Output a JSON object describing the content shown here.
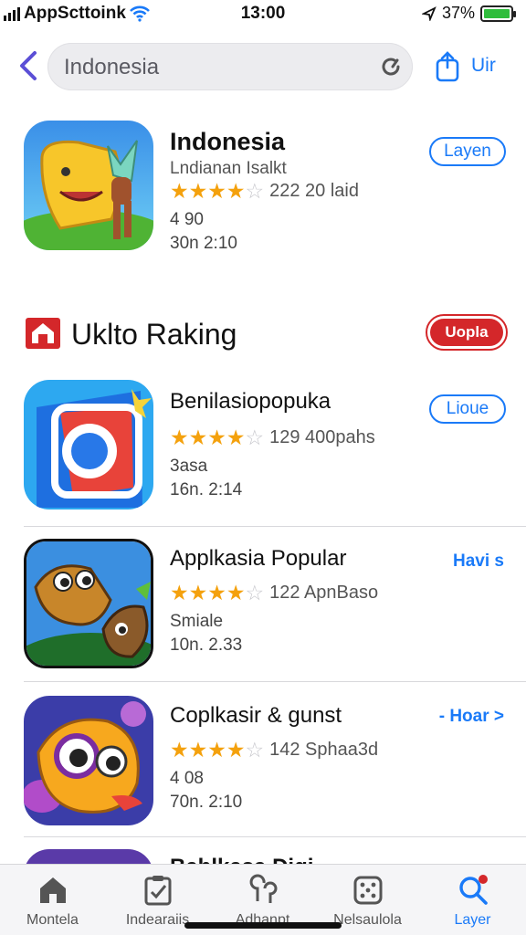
{
  "status_bar": {
    "carrier": "AppSсttoink",
    "time": "13:00",
    "battery": "37%"
  },
  "nav": {
    "search_query": "Indonesia",
    "right_label": "Uir"
  },
  "top_result": {
    "title": "Indonesia",
    "subtitle": "Lndianan Isalkt",
    "stars": 4,
    "rating_text": "222 20 laid",
    "meta1": "4 90",
    "meta2": "30n 2:10",
    "button": "Layen"
  },
  "section": {
    "title": "Uklto Raking",
    "button": "Uopla"
  },
  "apps": [
    {
      "title": "Benilasiopopuka",
      "stars": 4,
      "rating_text": "129 400pahs",
      "meta1": "3asa",
      "meta2": "16n. 2:14",
      "button": "Lioue"
    },
    {
      "title": "Applkasia Popular",
      "stars": 4,
      "rating_text": "122 ApnBaso",
      "meta1": "Smiale",
      "meta2": "10n. 2.33",
      "button": "Havi s"
    },
    {
      "title": "Coplkasir & gunst",
      "stars": 4,
      "rating_text": "142 Sphaa3d",
      "meta1": "4 08",
      "meta2": "70n. 2:10",
      "button": "- Hoar >"
    },
    {
      "title": "Bablkasa Digi",
      "partial": true
    }
  ],
  "tab_bar": {
    "tabs": [
      {
        "label": "Montela",
        "icon": "home-icon"
      },
      {
        "label": "Indearaiis",
        "icon": "clipboard-check-icon"
      },
      {
        "label": "Adhanpt",
        "icon": "apps-icon"
      },
      {
        "label": "Nelsaulola",
        "icon": "dice-icon"
      },
      {
        "label": "Layer",
        "icon": "search-icon",
        "active": true
      }
    ]
  },
  "colors": {
    "accent": "#1a7af8",
    "star": "#f4a10d",
    "danger": "#d4272a"
  }
}
